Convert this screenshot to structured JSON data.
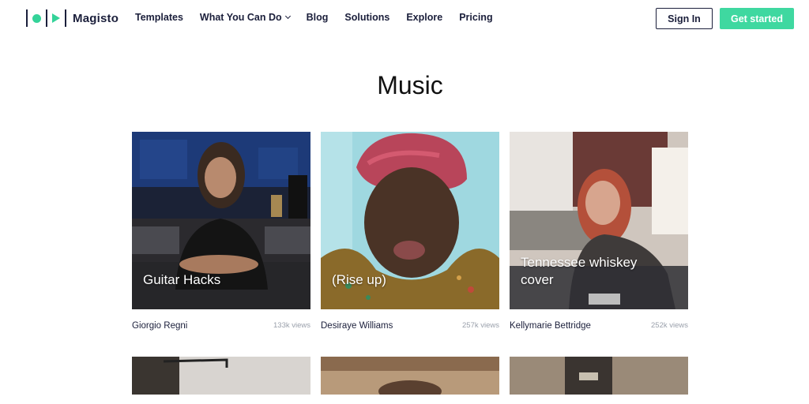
{
  "brand": {
    "name": "Magisto"
  },
  "nav": {
    "items": [
      {
        "label": "Templates"
      },
      {
        "label": "What You Can Do"
      },
      {
        "label": "Blog"
      },
      {
        "label": "Solutions"
      },
      {
        "label": "Explore"
      },
      {
        "label": "Pricing"
      }
    ],
    "sign_in": "Sign In",
    "get_started": "Get started"
  },
  "page": {
    "title": "Music"
  },
  "videos": [
    {
      "caption": "Guitar Hacks",
      "author": "Giorgio Regni",
      "views": "133k views"
    },
    {
      "caption": "(Rise up)",
      "author": "Desiraye Williams",
      "views": "257k views"
    },
    {
      "caption": "Tennessee whiskey cover",
      "author": "Kellymarie Bettridge",
      "views": "252k views"
    }
  ],
  "colors": {
    "brand_green": "#3fd8a0",
    "text_dark": "#1b1f3b"
  }
}
